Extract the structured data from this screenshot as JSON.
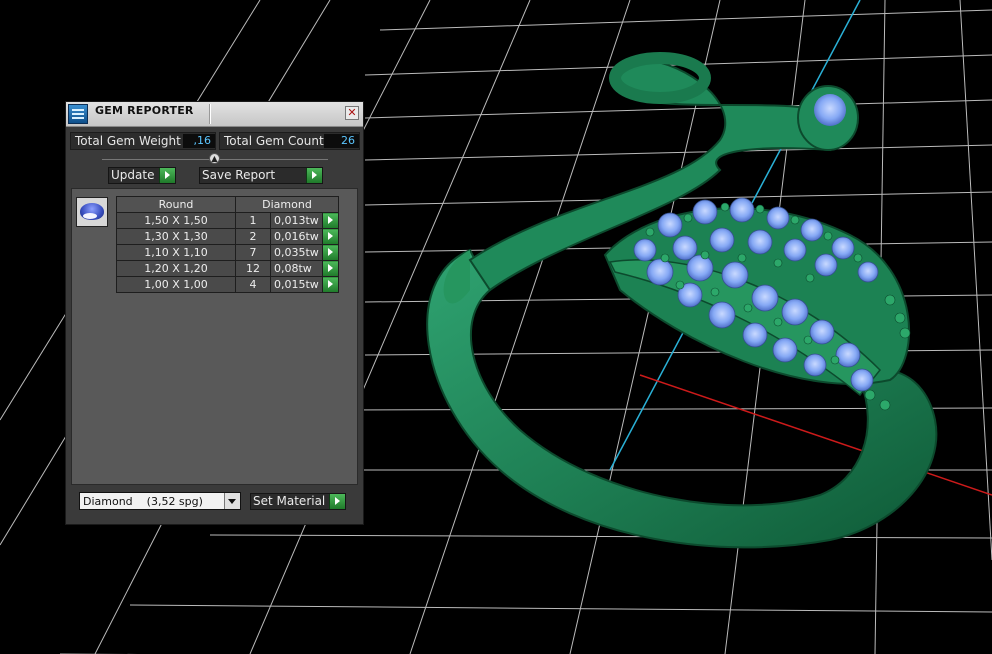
{
  "panel": {
    "title": "GEM REPORTER",
    "close_icon": "close-icon",
    "total_weight_label": "Total Gem Weight",
    "total_weight_value": ",16",
    "total_count_label": "Total Gem Count",
    "total_count_value": "26",
    "update_label": "Update",
    "save_report_label": "Save Report",
    "table": {
      "headers": [
        "Round",
        "Diamond"
      ],
      "rows": [
        {
          "size": "1,50 X 1,50",
          "count": "1",
          "weight": "0,013tw"
        },
        {
          "size": "1,30 X 1,30",
          "count": "2",
          "weight": "0,016tw"
        },
        {
          "size": "1,10 X 1,10",
          "count": "7",
          "weight": "0,035tw"
        },
        {
          "size": "1,20 X 1,20",
          "count": "12",
          "weight": "0,08tw"
        },
        {
          "size": "1,00 X 1,00",
          "count": "4",
          "weight": "0,015tw"
        }
      ]
    },
    "material_select": "Diamond    (3,52 spg)",
    "set_material_label": "Set Material"
  },
  "colors": {
    "viewport_bg": "#000000",
    "grid": "#e8e8e8",
    "model_green": "#1f8a5a",
    "gem_blue": "#8fb4ff",
    "axis_red": "#cc1a1a",
    "axis_blue": "#2ab0d6"
  }
}
